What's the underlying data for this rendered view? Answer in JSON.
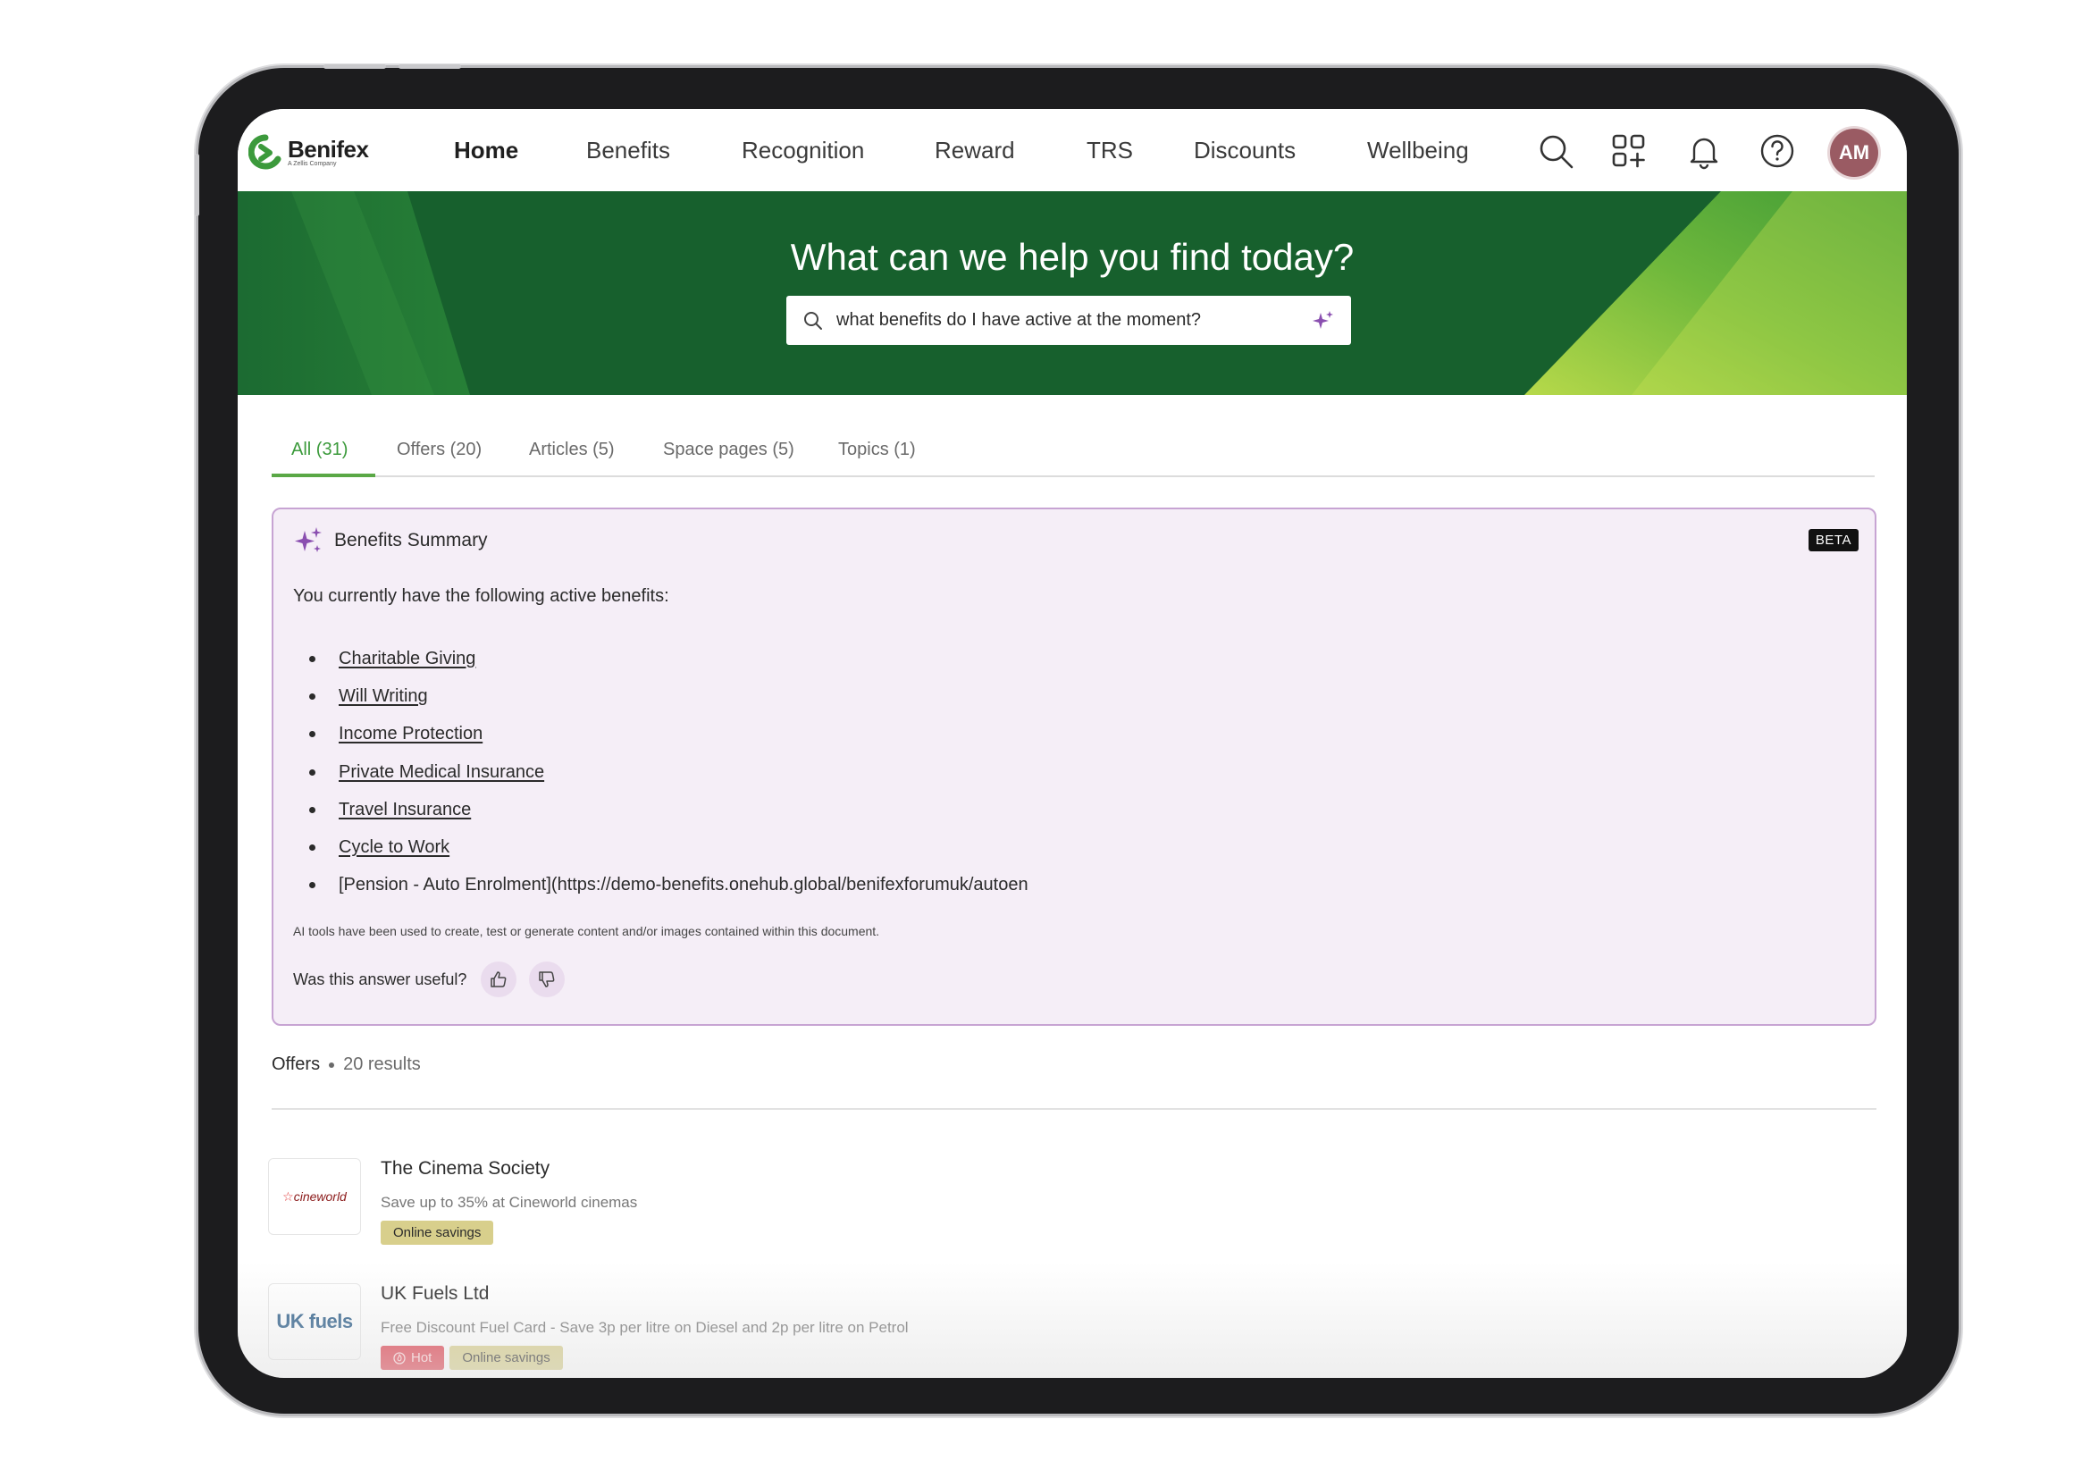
{
  "brand": {
    "name": "Benifex",
    "tagline": "A Zellis Company",
    "color": "#3c9a3c"
  },
  "nav": {
    "items": [
      {
        "label": "Home",
        "active": true
      },
      {
        "label": "Benefits",
        "active": false
      },
      {
        "label": "Recognition",
        "active": false
      },
      {
        "label": "Reward",
        "active": false
      },
      {
        "label": "TRS",
        "active": false
      },
      {
        "label": "Discounts",
        "active": false
      },
      {
        "label": "Wellbeing",
        "active": false
      }
    ],
    "icons": [
      "search-icon",
      "apps-icon",
      "bell-icon",
      "help-icon"
    ],
    "avatar_initials": "AM"
  },
  "hero": {
    "title": "What can we help you find today?",
    "search_value": "what benefits do I have active at the moment?"
  },
  "tabs": [
    {
      "label": "All (31)",
      "active": true
    },
    {
      "label": "Offers (20)",
      "active": false
    },
    {
      "label": "Articles (5)",
      "active": false
    },
    {
      "label": "Space pages (5)",
      "active": false
    },
    {
      "label": "Topics (1)",
      "active": false
    }
  ],
  "summary": {
    "title": "Benefits Summary",
    "badge": "BETA",
    "intro": "You currently have the following active benefits:",
    "benefits": [
      {
        "label": "Charitable Giving",
        "link": true
      },
      {
        "label": "Will Writing",
        "link": true
      },
      {
        "label": "Income Protection",
        "link": true
      },
      {
        "label": "Private Medical Insurance",
        "link": true
      },
      {
        "label": "Travel Insurance",
        "link": true
      },
      {
        "label": "Cycle to Work",
        "link": true
      },
      {
        "label": "[Pension - Auto Enrolment](https://demo-benefits.onehub.global/benifexforumuk/autoen",
        "link": false
      }
    ],
    "disclaimer": "AI tools have been used to create, test or generate content and/or images contained within this document.",
    "feedback_prompt": "Was this answer useful?"
  },
  "offers": {
    "label": "Offers",
    "count": "20 results",
    "items": [
      {
        "logo_text": "cineworld",
        "name": "The Cinema Society",
        "description": "Save up to 35% at Cineworld cinemas",
        "tags": [
          {
            "label": "Online savings",
            "type": "savings"
          }
        ]
      },
      {
        "logo_text": "UK fuels",
        "name": "UK Fuels Ltd",
        "description": "Free Discount Fuel Card - Save 3p per litre on Diesel and 2p per litre on Petrol",
        "tags": [
          {
            "label": "Hot",
            "type": "hot"
          },
          {
            "label": "Online savings",
            "type": "savings"
          }
        ]
      }
    ]
  },
  "colors": {
    "hero_green": "#17602d",
    "accent_green": "#5aa846",
    "summary_bg": "#f5eef7",
    "summary_border": "#c7a4d3",
    "ai_purple": "#8a4fb0",
    "tag_savings": "#d8cf8c",
    "tag_hot": "#e0414f"
  }
}
